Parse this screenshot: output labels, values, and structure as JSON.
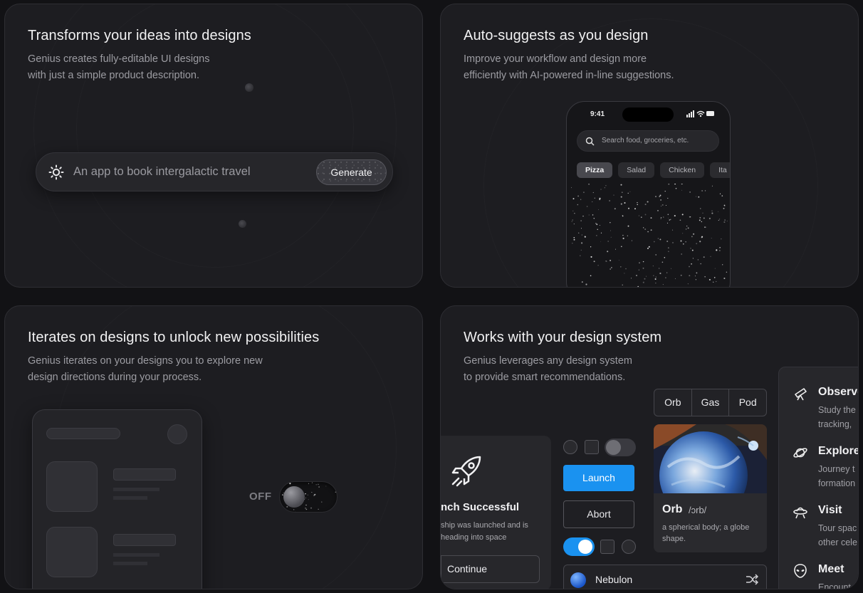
{
  "cards": {
    "transform": {
      "title": "Transforms your ideas into designs",
      "desc_line1": "Genius creates fully-editable UI designs",
      "desc_line2": "with just a simple product description.",
      "prompt": {
        "icon": "sparkle-gear-icon",
        "text": "An app to book intergalactic travel",
        "button": "Generate"
      }
    },
    "suggest": {
      "title": "Auto-suggests as you design",
      "desc_line1": "Improve your workflow and design more",
      "desc_line2": "efficiently with AI-powered in-line suggestions.",
      "phone": {
        "time": "9:41",
        "search_placeholder": "Search food, groceries, etc.",
        "chips": [
          "Pizza",
          "Salad",
          "Chicken",
          "Ita"
        ]
      }
    },
    "iterate": {
      "title": "Iterates on designs to unlock new possibilities",
      "desc_line1": "Genius iterates on your designs you to explore new",
      "desc_line2": "design directions during your process.",
      "toggle_label": "OFF"
    },
    "system": {
      "title": "Works with your design system",
      "desc_line1": "Genius leverages any design system",
      "desc_line2": "to provide smart recommendations.",
      "segments": [
        "Orb",
        "Gas",
        "Pod"
      ],
      "orb_card": {
        "name": "Orb",
        "phonetic": "/ɔrb/",
        "definition": "a spherical body; a globe shape."
      },
      "launch_card": {
        "title": "nch Successful",
        "desc_line1": "ship was launched and is",
        "desc_line2": "heading into space",
        "button": "Continue"
      },
      "buttons": {
        "primary": "Launch",
        "secondary": "Abort"
      },
      "select": {
        "value": "Nebulon",
        "icon": "shuffle-icon"
      },
      "side_panel": [
        {
          "icon": "telescope-icon",
          "title": "Observe",
          "line1": "Study the",
          "line2": "tracking,"
        },
        {
          "icon": "planet-icon",
          "title": "Explore",
          "line1": "Journey t",
          "line2": "formation"
        },
        {
          "icon": "ufo-icon",
          "title": "Visit",
          "line1": "Tour spac",
          "line2": "other cele"
        },
        {
          "icon": "alien-icon",
          "title": "Meet",
          "line1": "Encount",
          "line2": ""
        }
      ]
    }
  },
  "colors": {
    "background": "#121215",
    "card": "#1d1d21",
    "accent_blue": "#1a92f0"
  }
}
